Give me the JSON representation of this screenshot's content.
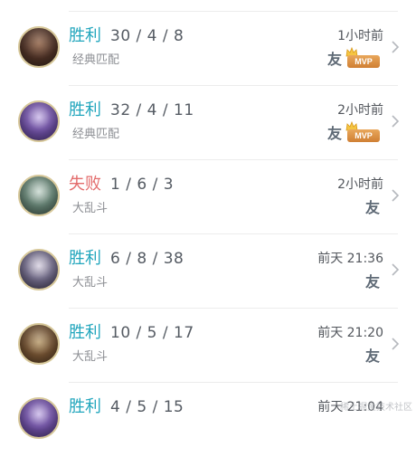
{
  "colors": {
    "win": "#22a6bd",
    "loss": "#e36c6c"
  },
  "matches": [
    {
      "result": "胜利",
      "outcome": "win",
      "kda": "30 / 4 / 8",
      "mode": "经典匹配",
      "time": "1小时前",
      "friend": "友",
      "mvp": "MVP",
      "avatar": "hero-dark-warrior"
    },
    {
      "result": "胜利",
      "outcome": "win",
      "kda": "32 / 4 / 11",
      "mode": "经典匹配",
      "time": "2小时前",
      "friend": "友",
      "mvp": "MVP",
      "avatar": "hero-purple-mage"
    },
    {
      "result": "失败",
      "outcome": "loss",
      "kda": "1 / 6 / 3",
      "mode": "大乱斗",
      "time": "2小时前",
      "friend": "友",
      "mvp": "",
      "avatar": "hero-armored-knight"
    },
    {
      "result": "胜利",
      "outcome": "win",
      "kda": "6 / 8 / 38",
      "mode": "大乱斗",
      "time": "前天 21:36",
      "friend": "友",
      "mvp": "",
      "avatar": "hero-pale-mage"
    },
    {
      "result": "胜利",
      "outcome": "win",
      "kda": "10 / 5 / 17",
      "mode": "大乱斗",
      "time": "前天 21:20",
      "friend": "友",
      "mvp": "",
      "avatar": "hero-yordle"
    },
    {
      "result": "胜利",
      "outcome": "win",
      "kda": "4 / 5 / 15",
      "mode": "",
      "time": "前天 21:04",
      "friend": "",
      "mvp": "",
      "avatar": "hero-purple-mage"
    }
  ],
  "watermark": "稀土掘金技术社区"
}
